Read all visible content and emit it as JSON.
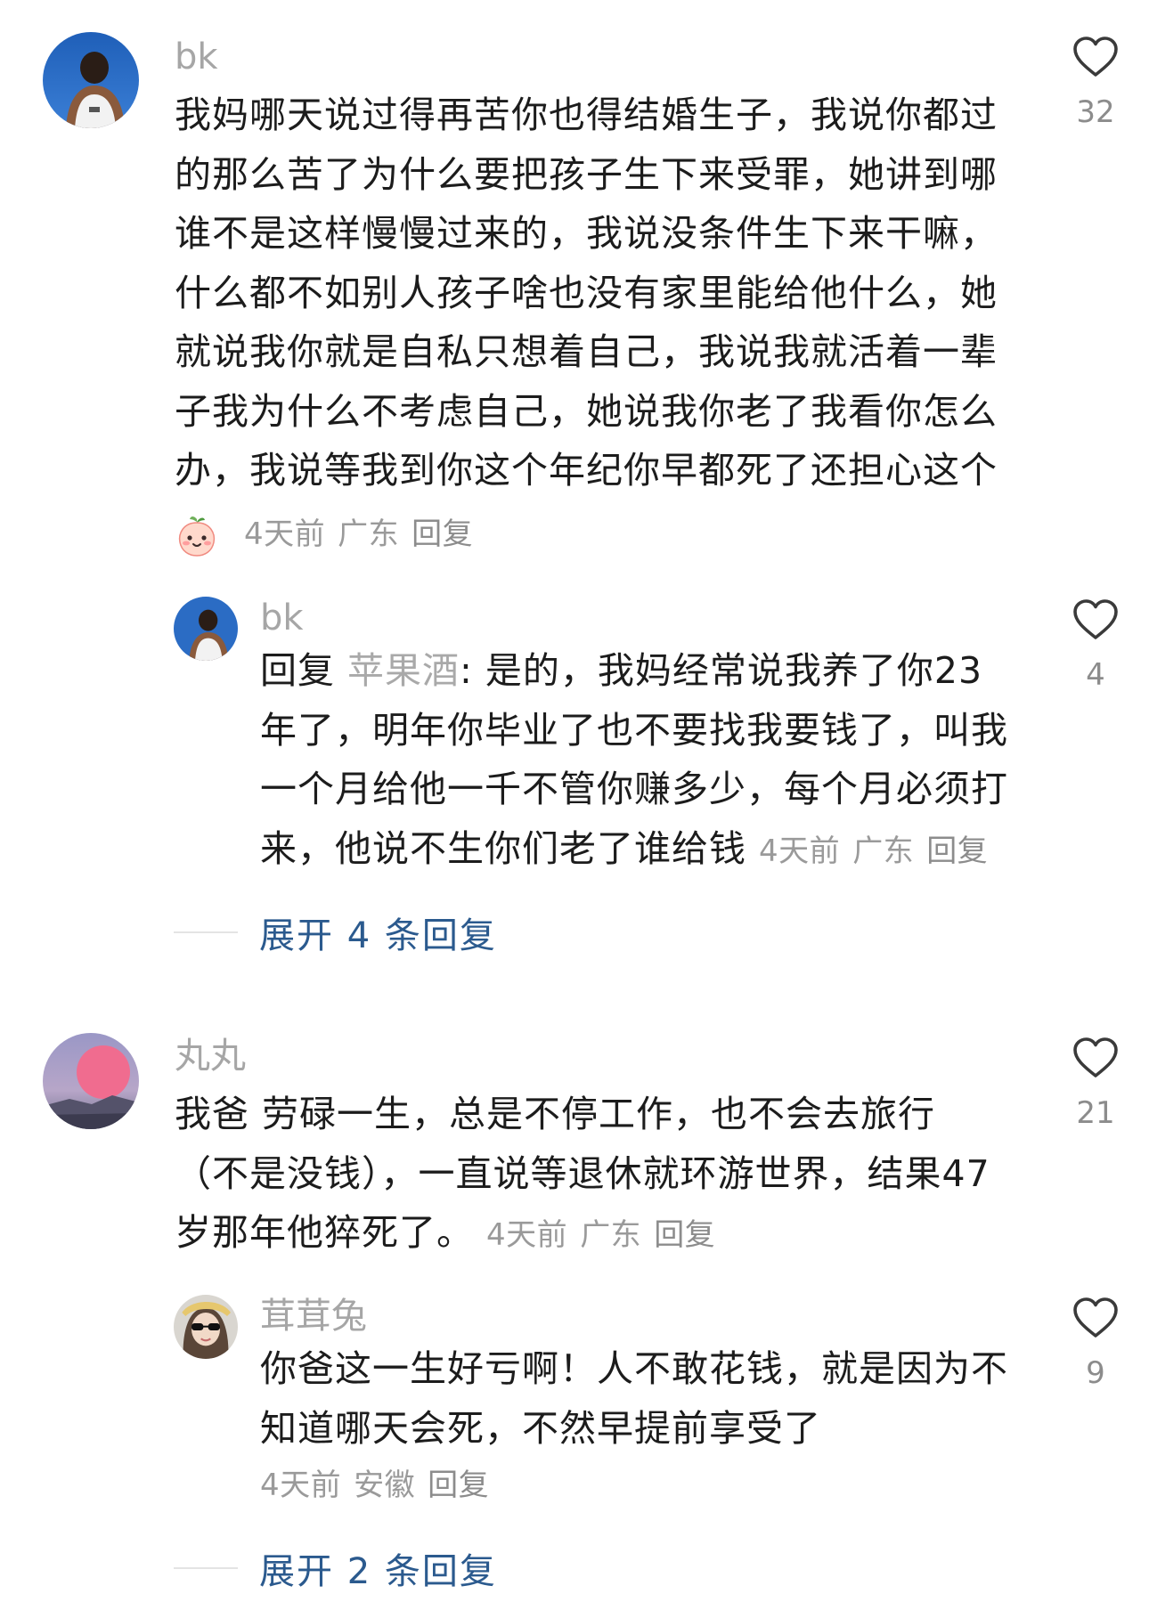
{
  "comments": [
    {
      "username": "bk",
      "text": "我妈哪天说过得再苦你也得结婚生子，我说你都过的那么苦了为什么要把孩子生下来受罪，她讲到哪谁不是这样慢慢过来的，我说没条件生下来干嘛，什么都不如别人孩子啥也没有家里能给他什么，她就说我你就是自私只想着自己，我说我就活着一辈子我为什么不考虑自己，她说我你老了我看你怎么办，我说等我到你这个年纪你早都死了还担心这个",
      "time": "4天前",
      "location": "广东",
      "reply_label": "回复",
      "likes": "32",
      "avatar_icon": "user-back-photo",
      "badge_icon": "peach-emoji-icon"
    },
    {
      "username": "bk",
      "reply_prefix": "回复",
      "mention": "苹果酒",
      "text": ": 是的，我妈经常说我养了你23年了，明年你毕业了也不要找我要钱了，叫我一个月给他一千不管你赚多少，每个月必须打来，他说不生你们老了谁给钱",
      "time": "4天前",
      "location": "广东",
      "reply_label": "回复",
      "likes": "4",
      "avatar_icon": "user-back-photo"
    },
    {
      "username": "丸丸",
      "text": "我爸 劳碌一生，总是不停工作，也不会去旅行（不是没钱），一直说等退休就环游世界，结果47岁那年他猝死了。",
      "time": "4天前",
      "location": "广东",
      "reply_label": "回复",
      "likes": "21",
      "avatar_icon": "pink-moon-photo"
    },
    {
      "username": "茸茸兔",
      "text": "你爸这一生好亏啊！人不敢花钱，就是因为不知道哪天会死，不然早提前享受了",
      "time": "4天前",
      "location": "安徽",
      "reply_label": "回复",
      "likes": "9",
      "avatar_icon": "girl-sunglasses-photo"
    }
  ],
  "expand_replies": [
    {
      "label": "展开 4 条回复"
    },
    {
      "label": "展开 2 条回复"
    }
  ],
  "colors": {
    "username": "#a6a6a6",
    "meta": "#9a9a9a",
    "expand": "#2b5a8e",
    "heart": "#3a3a3a"
  }
}
